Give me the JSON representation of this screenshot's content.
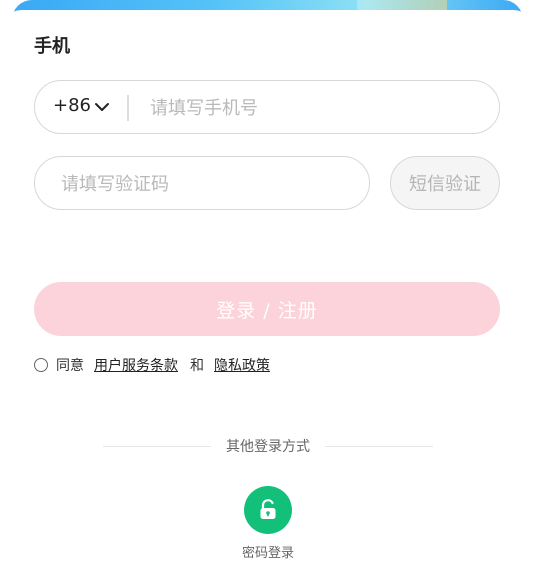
{
  "form": {
    "section_label": "手机",
    "country_code": "+86",
    "phone_placeholder": "请填写手机号",
    "code_placeholder": "请填写验证码",
    "sms_button_label": "短信验证",
    "login_button_label": "登录 / 注册"
  },
  "agreement": {
    "agree_text": "同意",
    "terms_link": "用户服务条款",
    "and_text": "和",
    "privacy_link": "隐私政策"
  },
  "other_login": {
    "label": "其他登录方式",
    "password_login_label": "密码登录",
    "password_icon": "unlock-icon"
  },
  "colors": {
    "accent_pink_disabled": "#fcd3da",
    "password_login_green": "#13c07a",
    "banner_blue": "#3aa8f5"
  }
}
